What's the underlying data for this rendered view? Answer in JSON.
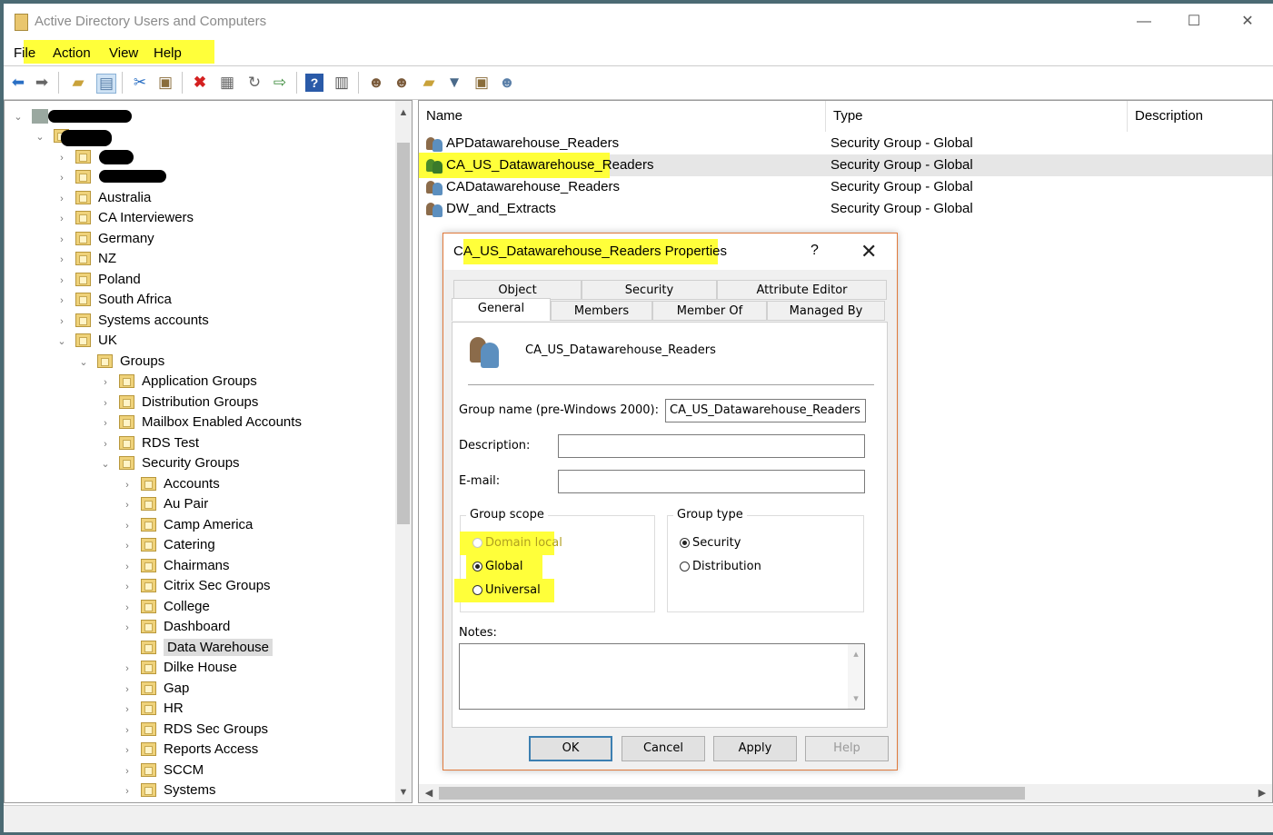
{
  "window": {
    "title": "Active Directory Users and Computers",
    "minimize": "—",
    "maximize": "☐",
    "close": "✕"
  },
  "menu": [
    "File",
    "Action",
    "View",
    "Help"
  ],
  "toolbar_icons": [
    "back-icon",
    "forward-icon",
    "up-folder-icon",
    "console-tree-icon",
    "cut-icon",
    "paste-icon",
    "delete-icon",
    "properties-icon",
    "refresh-icon",
    "export-icon",
    "help-icon",
    "show-hide-icon",
    "add-user-icon",
    "add-group-icon",
    "add-ou-icon",
    "filter-icon",
    "find-icon",
    "add-to-group-icon"
  ],
  "tree": {
    "items": [
      {
        "label": "Australia"
      },
      {
        "label": "CA Interviewers"
      },
      {
        "label": "Germany"
      },
      {
        "label": "NZ"
      },
      {
        "label": "Poland"
      },
      {
        "label": "South Africa"
      },
      {
        "label": "Systems accounts"
      },
      {
        "label": "UK"
      },
      {
        "label": "Groups"
      },
      {
        "label": "Application Groups"
      },
      {
        "label": "Distribution Groups"
      },
      {
        "label": "Mailbox Enabled Accounts"
      },
      {
        "label": "RDS Test"
      },
      {
        "label": "Security Groups"
      },
      {
        "label": "Accounts"
      },
      {
        "label": "Au Pair"
      },
      {
        "label": "Camp America"
      },
      {
        "label": "Catering"
      },
      {
        "label": "Chairmans"
      },
      {
        "label": "Citrix Sec Groups"
      },
      {
        "label": "College"
      },
      {
        "label": "Dashboard"
      },
      {
        "label": "Data Warehouse"
      },
      {
        "label": "Dilke House"
      },
      {
        "label": "Gap"
      },
      {
        "label": "HR"
      },
      {
        "label": "RDS Sec Groups"
      },
      {
        "label": "Reports Access"
      },
      {
        "label": "SCCM"
      },
      {
        "label": "Systems"
      }
    ],
    "partial_label_suffix": "s"
  },
  "list": {
    "columns": [
      "Name",
      "Type",
      "Description"
    ],
    "rows": [
      {
        "name": "APDatawarehouse_Readers",
        "type": "Security Group - Global"
      },
      {
        "name": "CA_US_Datawarehouse_Readers",
        "type": "Security Group - Global"
      },
      {
        "name": "CADatawarehouse_Readers",
        "type": "Security Group - Global"
      },
      {
        "name": "DW_and_Extracts",
        "type": "Security Group - Global"
      }
    ]
  },
  "dialog": {
    "title": "CA_US_Datawarehouse_Readers Properties",
    "help": "?",
    "close": "✕",
    "tabs_back": [
      "Object",
      "Security",
      "Attribute Editor"
    ],
    "tabs_front": [
      "General",
      "Members",
      "Member Of",
      "Managed By"
    ],
    "group_display_name": "CA_US_Datawarehouse_Readers",
    "group_name_label": "Group name (pre-Windows 2000):",
    "group_name_value": "CA_US_Datawarehouse_Readers",
    "description_label": "Description:",
    "description_value": "",
    "email_label": "E-mail:",
    "email_value": "",
    "scope_title": "Group scope",
    "scope_options": [
      "Domain local",
      "Global",
      "Universal"
    ],
    "scope_selected": "Global",
    "type_title": "Group type",
    "type_options": [
      "Security",
      "Distribution"
    ],
    "type_selected": "Security",
    "notes_label": "Notes:",
    "notes_value": "",
    "buttons": {
      "ok": "OK",
      "cancel": "Cancel",
      "apply": "Apply",
      "help": "Help"
    }
  },
  "highlight_color": "#ffff3a"
}
